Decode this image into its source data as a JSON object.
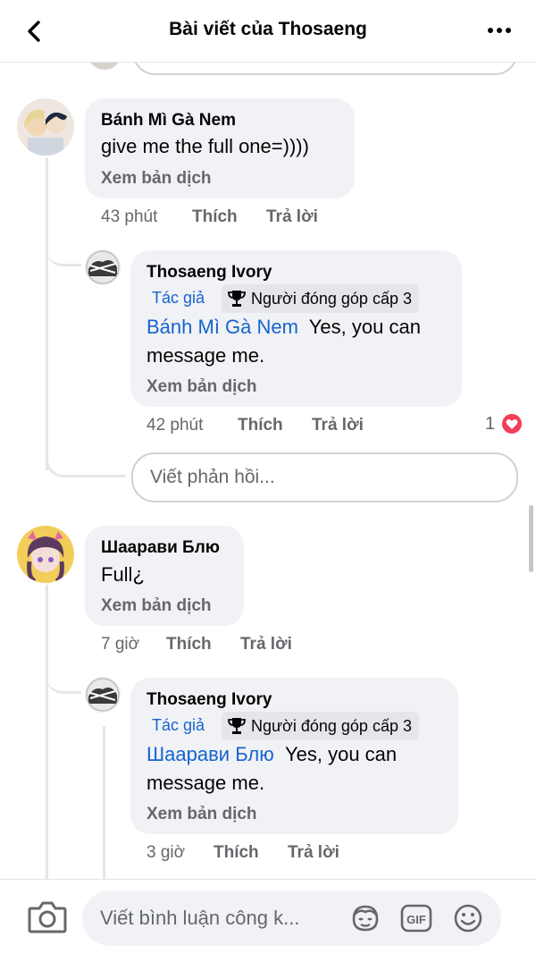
{
  "header": {
    "title": "Bài viết của Thosaeng"
  },
  "comments": [
    {
      "author": "Bánh Mì Gà Nem",
      "text": "give me the full one=))))",
      "translate": "Xem bản dịch",
      "time": "43 phút",
      "like": "Thích",
      "reply": "Trả lời",
      "replies": [
        {
          "author": "Thosaeng Ivory",
          "author_badge": "Tác giả",
          "contributor_badge": "Người đóng góp cấp 3",
          "mention": "Bánh Mì Gà Nem",
          "text_line1": "Yes, you can",
          "text_line2": "message me.",
          "translate": "Xem bản dịch",
          "time": "42 phút",
          "like": "Thích",
          "reply": "Trả lời",
          "reaction_count": "1"
        }
      ],
      "reply_input_placeholder": "Viết phản hồi..."
    },
    {
      "author": "Шаарави Блю",
      "text": "Full¿",
      "translate": "Xem bản dịch",
      "time": "7 giờ",
      "like": "Thích",
      "reply": "Trả lời",
      "replies": [
        {
          "author": "Thosaeng Ivory",
          "author_badge": "Tác giả",
          "contributor_badge": "Người đóng góp cấp 3",
          "mention": "Шаарави Блю",
          "text_line1": "Yes, you can",
          "text_line2": "message me.",
          "translate": "Xem bản dịch",
          "time": "3 giờ",
          "like": "Thích",
          "reply": "Trả lời"
        }
      ]
    }
  ],
  "composer": {
    "placeholder": "Viết bình luận công k..."
  },
  "icons": {
    "back": "chevron-left-icon",
    "more": "more-horizontal-icon",
    "trophy": "trophy-icon",
    "heart": "heart-reaction-icon",
    "camera": "camera-icon",
    "avatar_sticker": "avatar-sticker-icon",
    "gif": "gif-icon",
    "emoji": "smiley-icon"
  },
  "colors": {
    "mention": "#1763cf",
    "heart": "#f33e58",
    "bubble": "#f0f2f5"
  }
}
